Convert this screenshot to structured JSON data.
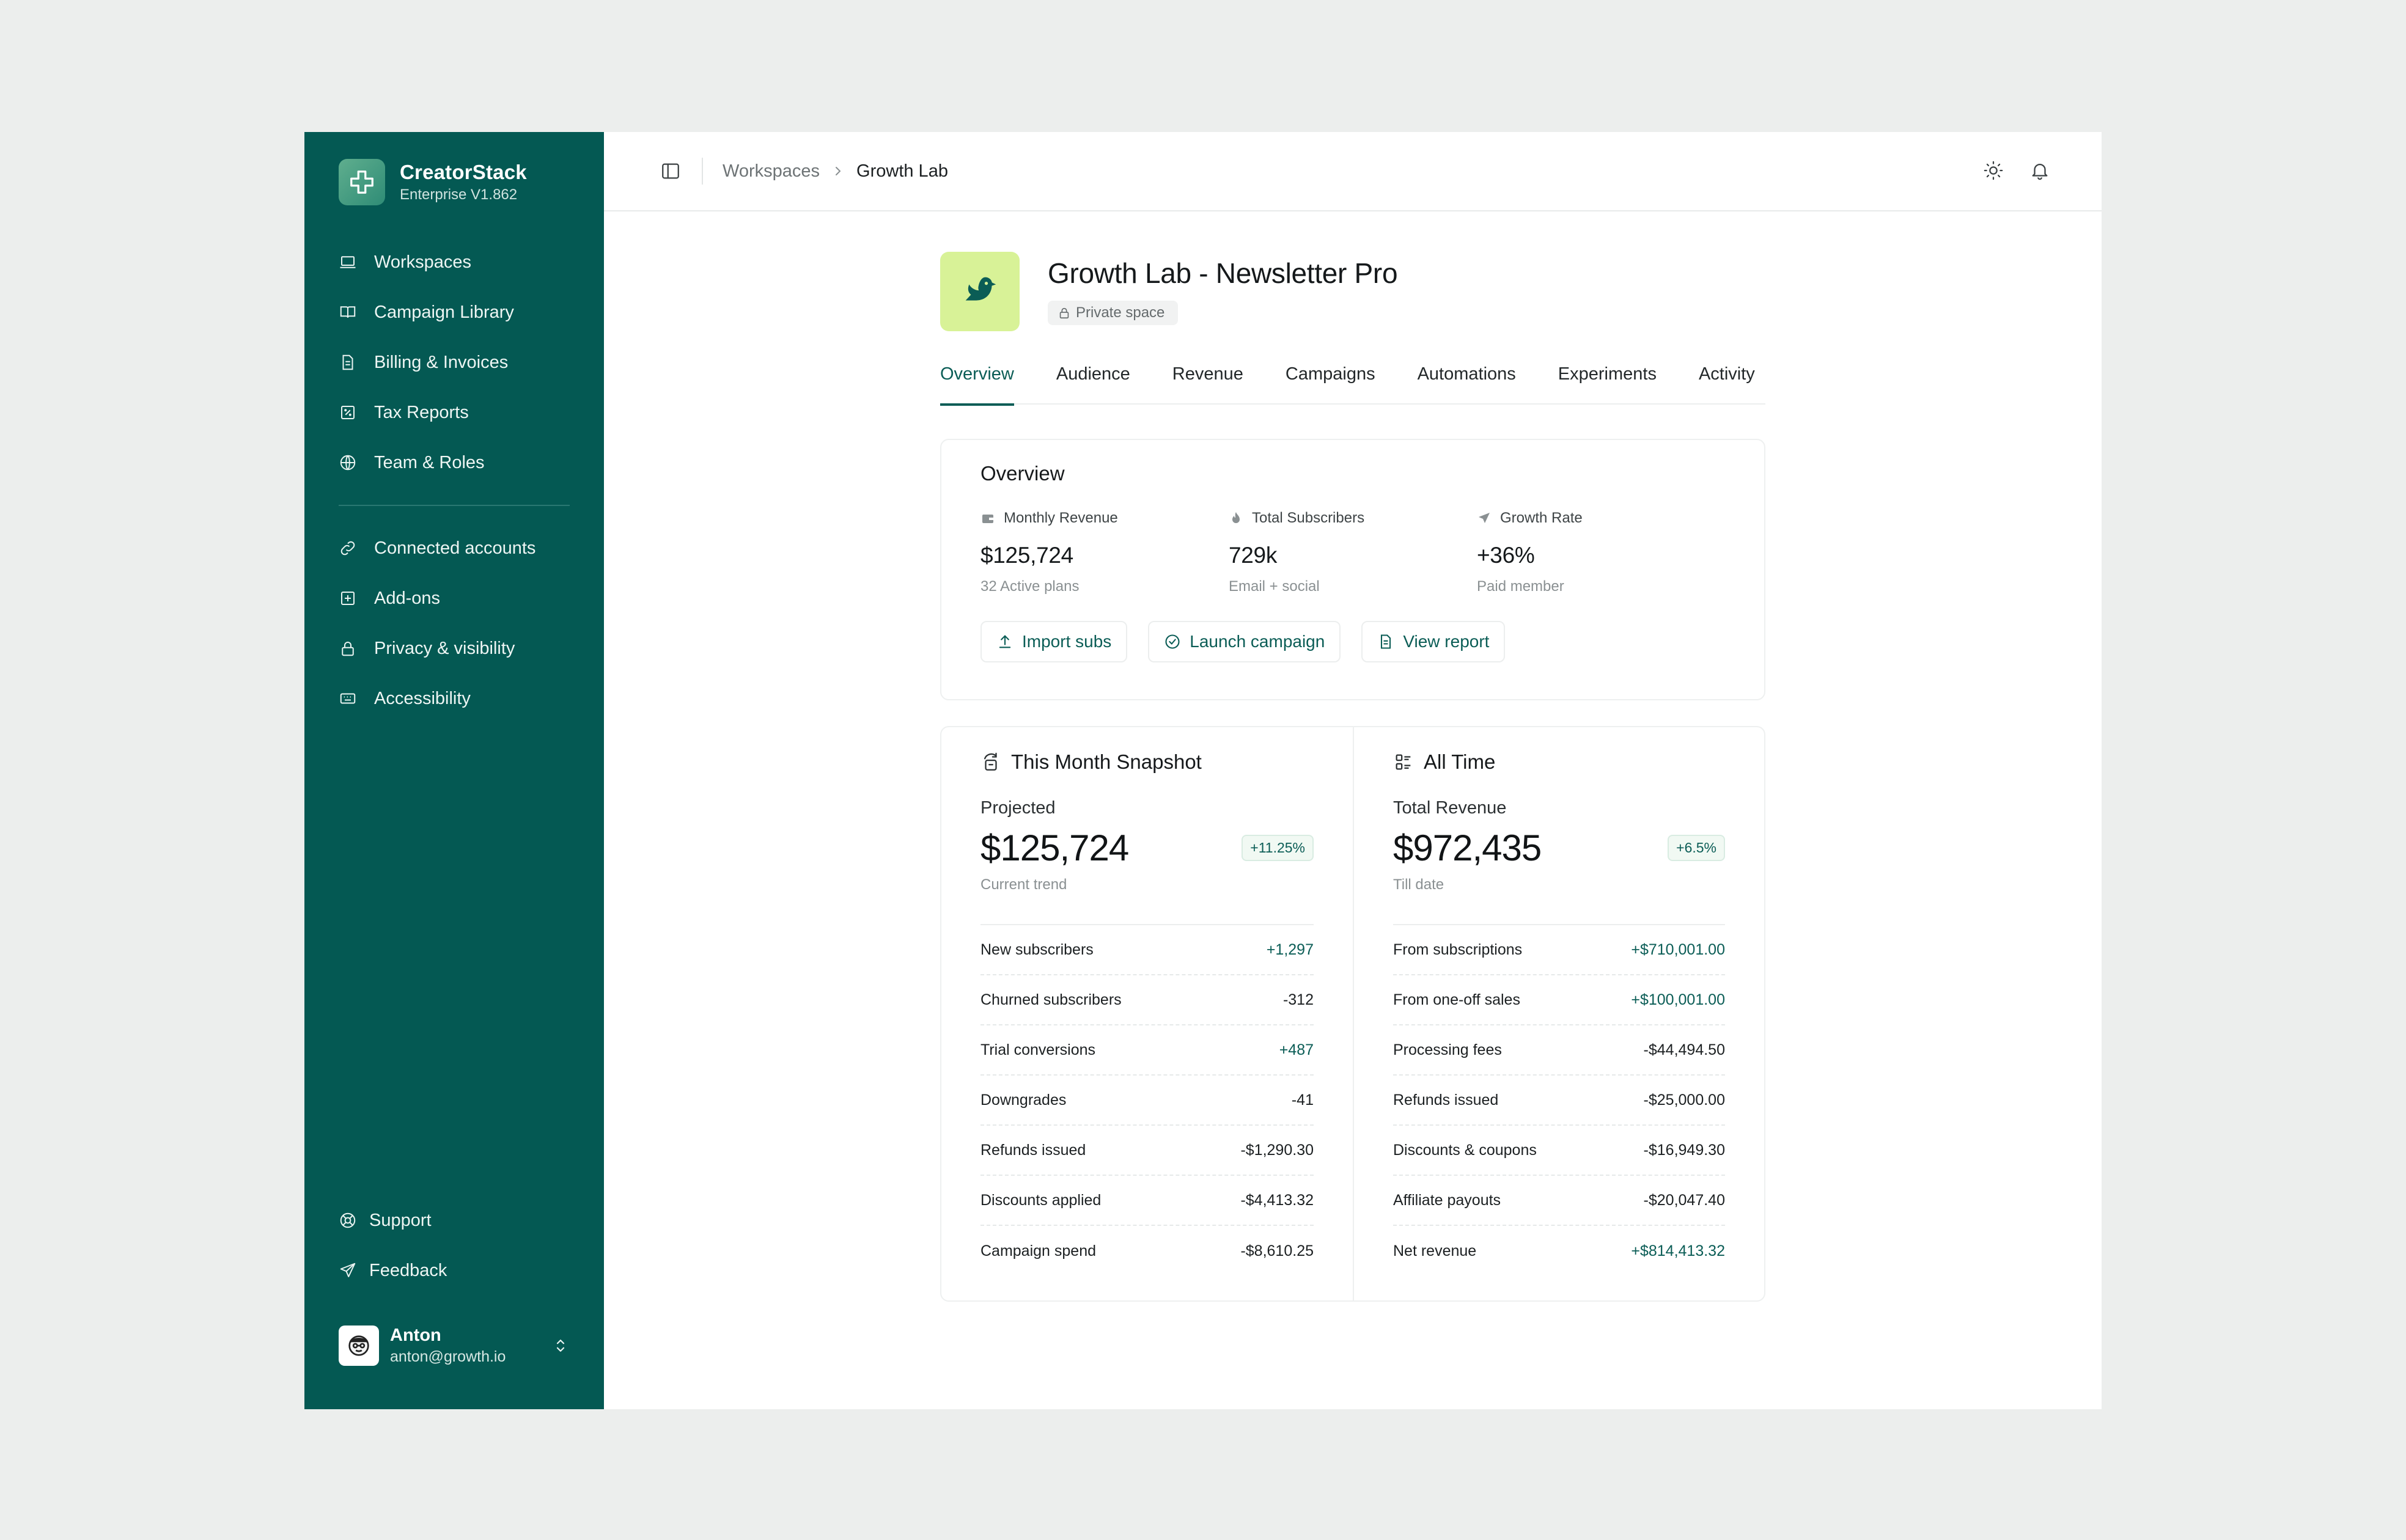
{
  "brand": {
    "name": "CreatorStack",
    "version": "Enterprise V1.862"
  },
  "sidebar": {
    "items": [
      {
        "label": "Workspaces",
        "icon": "laptop-icon"
      },
      {
        "label": "Campaign Library",
        "icon": "book-icon"
      },
      {
        "label": "Billing & Invoices",
        "icon": "document-icon"
      },
      {
        "label": "Tax Reports",
        "icon": "percent-square-icon"
      },
      {
        "label": "Team & Roles",
        "icon": "globe-icon"
      }
    ],
    "items2": [
      {
        "label": "Connected accounts",
        "icon": "link-icon"
      },
      {
        "label": "Add-ons",
        "icon": "plus-square-icon"
      },
      {
        "label": "Privacy & visibility",
        "icon": "lock-icon"
      },
      {
        "label": "Accessibility",
        "icon": "keyboard-icon"
      }
    ],
    "bottom": [
      {
        "label": "Support",
        "icon": "lifebuoy-icon"
      },
      {
        "label": "Feedback",
        "icon": "send-icon"
      }
    ],
    "user": {
      "name": "Anton",
      "email": "anton@growth.io"
    }
  },
  "breadcrumb": {
    "parent": "Workspaces",
    "current": "Growth Lab"
  },
  "space": {
    "title": "Growth Lab - Newsletter Pro",
    "badge": "Private space"
  },
  "tabs": [
    "Overview",
    "Audience",
    "Revenue",
    "Campaigns",
    "Automations",
    "Experiments",
    "Activity"
  ],
  "overview": {
    "title": "Overview",
    "stats": [
      {
        "label": "Monthly Revenue",
        "value": "$125,724",
        "sub": "32 Active plans"
      },
      {
        "label": "Total Subscribers",
        "value": "729k",
        "sub": "Email + social"
      },
      {
        "label": "Growth Rate",
        "value": "+36%",
        "sub": "Paid member"
      }
    ],
    "actions": [
      "Import subs",
      "Launch campaign",
      "View report"
    ]
  },
  "month": {
    "title": "This Month Snapshot",
    "sub": "Projected",
    "value": "$125,724",
    "change": "+11.25%",
    "caption": "Current trend",
    "rows": [
      {
        "label": "New subscribers",
        "value": "+1,297",
        "positive": true
      },
      {
        "label": "Churned subscribers",
        "value": "-312",
        "positive": false
      },
      {
        "label": "Trial conversions",
        "value": "+487",
        "positive": true
      },
      {
        "label": "Downgrades",
        "value": "-41",
        "positive": false
      },
      {
        "label": "Refunds issued",
        "value": "-$1,290.30",
        "positive": false
      },
      {
        "label": "Discounts applied",
        "value": "-$4,413.32",
        "positive": false
      },
      {
        "label": "Campaign spend",
        "value": "-$8,610.25",
        "positive": false
      }
    ]
  },
  "alltime": {
    "title": "All Time",
    "sub": "Total Revenue",
    "value": "$972,435",
    "change": "+6.5%",
    "caption": "Till date",
    "rows": [
      {
        "label": "From subscriptions",
        "value": "+$710,001.00",
        "positive": true
      },
      {
        "label": "From one-off sales",
        "value": "+$100,001.00",
        "positive": true
      },
      {
        "label": "Processing fees",
        "value": "-$44,494.50",
        "positive": false
      },
      {
        "label": "Refunds issued",
        "value": "-$25,000.00",
        "positive": false
      },
      {
        "label": "Discounts & coupons",
        "value": "-$16,949.30",
        "positive": false
      },
      {
        "label": "Affiliate payouts",
        "value": "-$20,047.40",
        "positive": false
      },
      {
        "label": "Net revenue",
        "value": "+$814,413.32",
        "positive": true
      }
    ]
  },
  "colors": {
    "sidebar": "#045953",
    "accent": "#0b5d56",
    "spaceLogo": "#d8f297"
  }
}
